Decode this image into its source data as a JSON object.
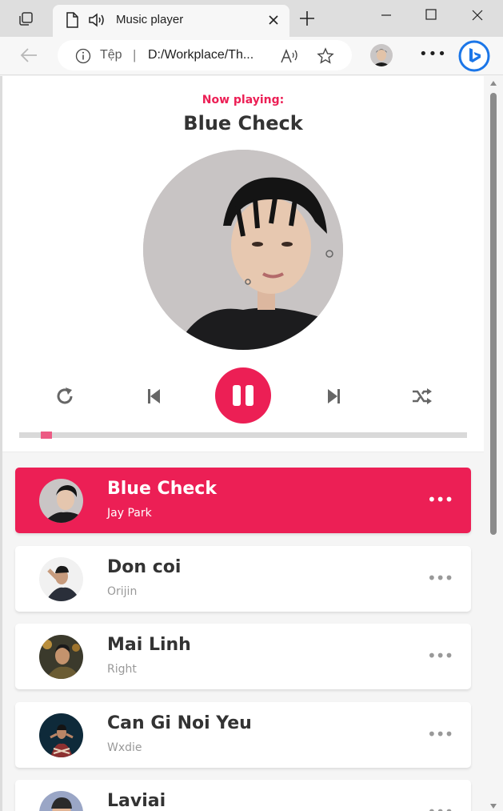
{
  "browser": {
    "tab_title": "Music player",
    "address_scheme": "Tệp",
    "address_separator": "|",
    "address_url": "D:/Workplace/Th...",
    "more_label": "•••"
  },
  "player": {
    "now_playing_label": "Now playing:",
    "current_title": "Blue Check",
    "progress": 0.06,
    "accent_color": "#ec1f55"
  },
  "playlist": [
    {
      "title": "Blue Check",
      "artist": "Jay Park",
      "active": true,
      "options": "•••"
    },
    {
      "title": "Don coi",
      "artist": "Orijin",
      "active": false,
      "options": "•••"
    },
    {
      "title": "Mai Linh",
      "artist": "Right",
      "active": false,
      "options": "•••"
    },
    {
      "title": "Can Gi Noi Yeu",
      "artist": "Wxdie",
      "active": false,
      "options": "•••"
    },
    {
      "title": "Laviai",
      "artist": "",
      "active": false,
      "options": "•••"
    }
  ],
  "icons": {
    "workspaces": "tab-actions-icon",
    "file": "file-icon",
    "speaker": "speaker-icon",
    "close": "close-icon",
    "new_tab": "plus-icon",
    "back": "back-arrow-icon",
    "info": "info-icon",
    "read_aloud": "read-aloud-icon",
    "favorite": "star-icon",
    "bing": "bing-icon",
    "repeat": "repeat-icon",
    "prev": "skip-previous-icon",
    "pause": "pause-icon",
    "next": "skip-next-icon",
    "shuffle": "shuffle-icon"
  }
}
